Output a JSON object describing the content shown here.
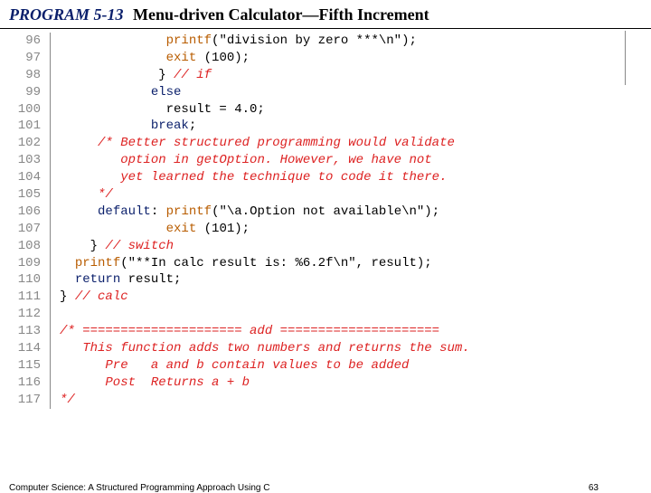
{
  "header": {
    "program_label": "PROGRAM 5-13",
    "title": "Menu-driven Calculator—Fifth Increment"
  },
  "lines": [
    {
      "n": "96",
      "segs": [
        {
          "t": "              "
        },
        {
          "t": "printf",
          "c": "fn"
        },
        {
          "t": "(\"division by zero ***\\n\");"
        }
      ]
    },
    {
      "n": "97",
      "segs": [
        {
          "t": "              "
        },
        {
          "t": "exit",
          "c": "fn"
        },
        {
          "t": " (100);"
        }
      ]
    },
    {
      "n": "98",
      "segs": [
        {
          "t": "             } "
        },
        {
          "t": "// if",
          "c": "cm"
        }
      ]
    },
    {
      "n": "99",
      "segs": [
        {
          "t": "            "
        },
        {
          "t": "else",
          "c": "kw"
        }
      ]
    },
    {
      "n": "100",
      "segs": [
        {
          "t": "              result = 4.0;"
        }
      ]
    },
    {
      "n": "101",
      "segs": [
        {
          "t": "            "
        },
        {
          "t": "break",
          "c": "kw"
        },
        {
          "t": ";"
        }
      ]
    },
    {
      "n": "102",
      "segs": [
        {
          "t": "     "
        },
        {
          "t": "/* Better structured programming would validate",
          "c": "cm"
        }
      ]
    },
    {
      "n": "103",
      "segs": [
        {
          "t": "        "
        },
        {
          "t": "option in getOption. However, we have not",
          "c": "cm"
        }
      ]
    },
    {
      "n": "104",
      "segs": [
        {
          "t": "        "
        },
        {
          "t": "yet learned the technique to code it there.",
          "c": "cm"
        }
      ]
    },
    {
      "n": "105",
      "segs": [
        {
          "t": "     "
        },
        {
          "t": "*/",
          "c": "cm"
        }
      ]
    },
    {
      "n": "106",
      "segs": [
        {
          "t": "     "
        },
        {
          "t": "default",
          "c": "kw"
        },
        {
          "t": ": "
        },
        {
          "t": "printf",
          "c": "fn"
        },
        {
          "t": "(\"\\a.Option not available\\n\");"
        }
      ]
    },
    {
      "n": "107",
      "segs": [
        {
          "t": "              "
        },
        {
          "t": "exit",
          "c": "fn"
        },
        {
          "t": " (101);"
        }
      ]
    },
    {
      "n": "108",
      "segs": [
        {
          "t": "    } "
        },
        {
          "t": "// switch",
          "c": "cm"
        }
      ]
    },
    {
      "n": "109",
      "segs": [
        {
          "t": "  "
        },
        {
          "t": "printf",
          "c": "fn"
        },
        {
          "t": "(\"**In calc result is: %6.2f\\n\", result);"
        }
      ]
    },
    {
      "n": "110",
      "segs": [
        {
          "t": "  "
        },
        {
          "t": "return",
          "c": "kw"
        },
        {
          "t": " result;"
        }
      ]
    },
    {
      "n": "111",
      "segs": [
        {
          "t": "} "
        },
        {
          "t": "// calc",
          "c": "cm"
        }
      ]
    },
    {
      "n": "112",
      "segs": [
        {
          "t": ""
        }
      ]
    },
    {
      "n": "113",
      "segs": [
        {
          "t": "/* ===================== add =====================",
          "c": "cm"
        }
      ]
    },
    {
      "n": "114",
      "segs": [
        {
          "t": "   This function adds two numbers and returns the sum.",
          "c": "cm"
        }
      ]
    },
    {
      "n": "115",
      "segs": [
        {
          "t": "      Pre   a and b contain values to be added",
          "c": "cm"
        }
      ]
    },
    {
      "n": "116",
      "segs": [
        {
          "t": "      Post  Returns a + b",
          "c": "cm"
        }
      ]
    },
    {
      "n": "117",
      "segs": [
        {
          "t": "*/",
          "c": "cm"
        }
      ]
    }
  ],
  "footer": {
    "book": "Computer Science: A Structured Programming Approach Using C",
    "page": "63"
  }
}
